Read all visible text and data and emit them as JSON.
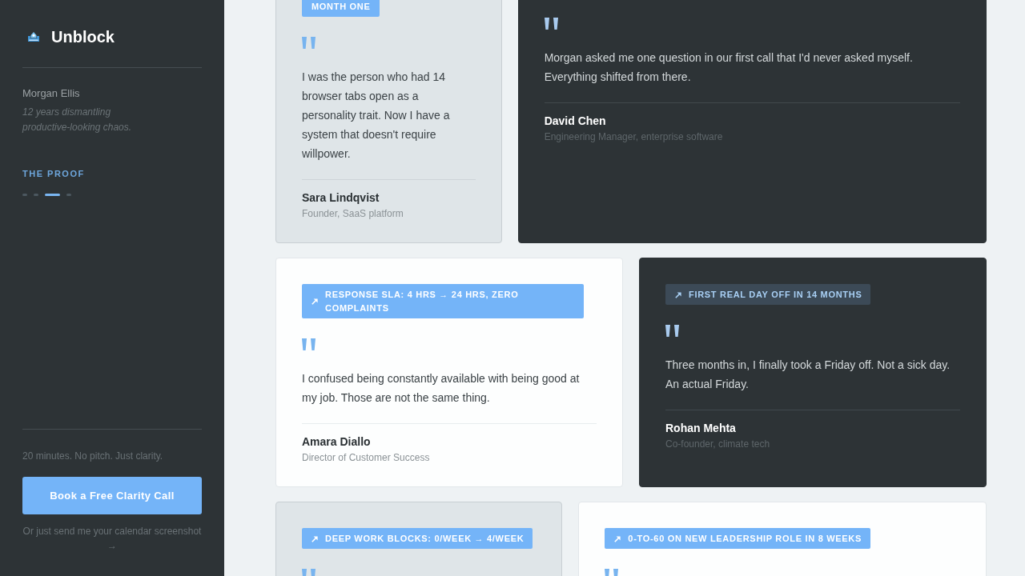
{
  "sidebar": {
    "brand": "Unblock",
    "author": {
      "name": "Morgan Ellis",
      "tagline": "12 years dismantling productive-looking chaos."
    },
    "section_label": "THE PROOF",
    "section_pager": [
      {
        "selected": false
      },
      {
        "selected": false
      },
      {
        "selected": true
      },
      {
        "selected": false
      }
    ],
    "cta": {
      "note": "20 minutes. No pitch. Just clarity.",
      "button": "Book a Free Clarity Call",
      "link": "Or just send me your calendar screenshot →"
    }
  },
  "testimonials": [
    {
      "kind": "muted",
      "badge": {
        "text": "MONTH ONE",
        "trend_icon": false
      },
      "quote": "I was the person who had 14 browser tabs open as a personality trait. Now I have a system that doesn't require willpower.",
      "name": "Sara Lindqvist",
      "role": "Founder, SaaS platform"
    },
    {
      "kind": "dark",
      "quote": "Morgan asked me one question in our first call that I'd never asked myself. Everything shifted from there.",
      "name": "David Chen",
      "role": "Engineering Manager, enterprise software"
    },
    {
      "kind": "light",
      "badge": {
        "text": "RESPONSE SLA: 4 HRS → 24 HRS, ZERO COMPLAINTS",
        "trend_icon": true
      },
      "quote": "I confused being constantly available with being good at my job. Those are not the same thing.",
      "name": "Amara Diallo",
      "role": "Director of Customer Success"
    },
    {
      "kind": "dark",
      "badge": {
        "text": "FIRST REAL DAY OFF IN 14 MONTHS",
        "trend_icon": true
      },
      "quote": "Three months in, I finally took a Friday off. Not a sick day. An actual Friday.",
      "name": "Rohan Mehta",
      "role": "Co-founder, climate tech"
    },
    {
      "kind": "muted",
      "badge": {
        "text": "DEEP WORK BLOCKS: 0/WEEK → 4/WEEK",
        "trend_icon": true
      }
    },
    {
      "kind": "light",
      "badge": {
        "text": "0-TO-60 ON NEW LEADERSHIP ROLE IN 8 WEEKS",
        "trend_icon": true
      }
    }
  ]
}
